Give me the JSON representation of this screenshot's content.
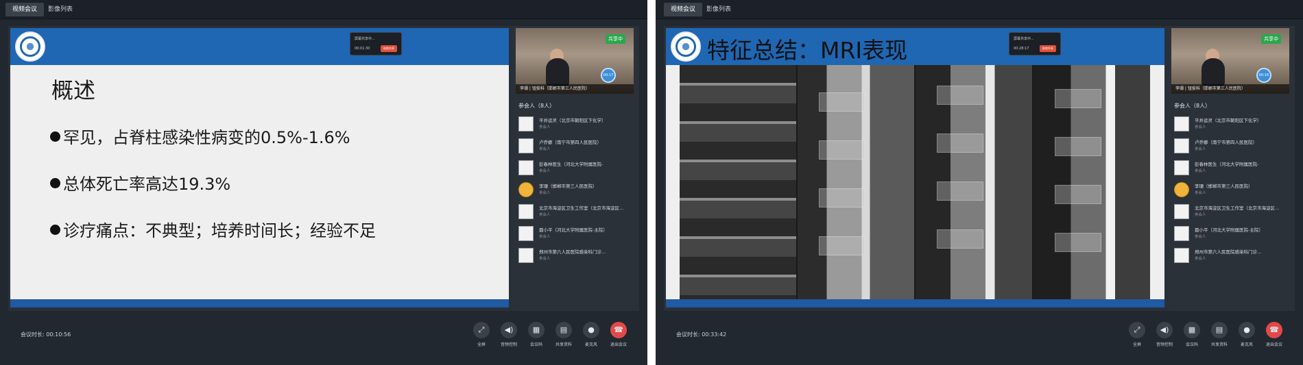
{
  "left": {
    "tabs": [
      "视频会议",
      "影像列表"
    ],
    "slide": {
      "title": "概述",
      "bullets": [
        "罕见，占脊柱感染性病变的0.5%-1.6%",
        "总体死亡率高达19.3%",
        "诊疗痛点：不典型；培养时间长；经验不足"
      ],
      "popup_title": "屏幕共享中...",
      "popup_time": "00:01:30",
      "popup_button": "结束共享"
    },
    "video": {
      "share_badge": "共享中",
      "name": "李珊 | 钮俊科（邯郸市第三人民医院）",
      "timer": "00:17"
    },
    "participants_title": "参会人（8人）",
    "participants": [
      {
        "name": "平井运灵（北京市朝阳区下化学）",
        "role": "参会人"
      },
      {
        "name": "卢乔娜（南宁市第四人民医院）",
        "role": "参会人"
      },
      {
        "name": "彭春林医生（河北大学附属医院-",
        "role": "参会人"
      },
      {
        "name": "李珊（邯郸市第三人民医院）",
        "role": "参会人"
      },
      {
        "name": "北京市海淀区卫生工作室（北京市海淀区...",
        "role": "参会人"
      },
      {
        "name": "聂小平（河北大学附属医院-主院）",
        "role": "参会人"
      },
      {
        "name": "郑州市第六人民医院感染科门诊...",
        "role": "参会人"
      }
    ],
    "duration_label": "会议时长:",
    "duration": "00:10:56"
  },
  "right": {
    "tabs": [
      "视频会议",
      "影像列表"
    ],
    "slide": {
      "title": "特征总结：MRI表现",
      "popup_title": "屏幕共享中...",
      "popup_time": "00:28:17",
      "popup_button": "结束共享"
    },
    "video": {
      "share_badge": "共享中",
      "name": "李珊 | 钮俊科（邯郸市第三人民医院）",
      "timer": "00:16"
    },
    "participants_title": "参会人（8人）",
    "participants": [
      {
        "name": "平井运灵（北京市朝阳区下化学）",
        "role": "参会人"
      },
      {
        "name": "卢乔娜（南宁市第四人民医院）",
        "role": "参会人"
      },
      {
        "name": "彭春林医生（河北大学附属医院-",
        "role": "参会人"
      },
      {
        "name": "李珊（邯郸市第三人民医院）",
        "role": "参会人"
      },
      {
        "name": "北京市海淀区卫生工作室（北京市海淀区...",
        "role": "参会人"
      },
      {
        "name": "聂小平（河北大学附属医院-主院）",
        "role": "参会人"
      },
      {
        "name": "郑州市第六人民医院感染科门诊...",
        "role": "参会人"
      }
    ],
    "duration_label": "会议时长:",
    "duration": "00:33:42"
  },
  "controls": [
    {
      "label": "全屏",
      "icon": "⤢"
    },
    {
      "label": "音频控制",
      "icon": "◀)"
    },
    {
      "label": "会议码",
      "icon": "▦"
    },
    {
      "label": "共享资料",
      "icon": "▤"
    },
    {
      "label": "麦克风",
      "icon": "●"
    },
    {
      "label": "退出会议",
      "icon": "☎"
    }
  ]
}
